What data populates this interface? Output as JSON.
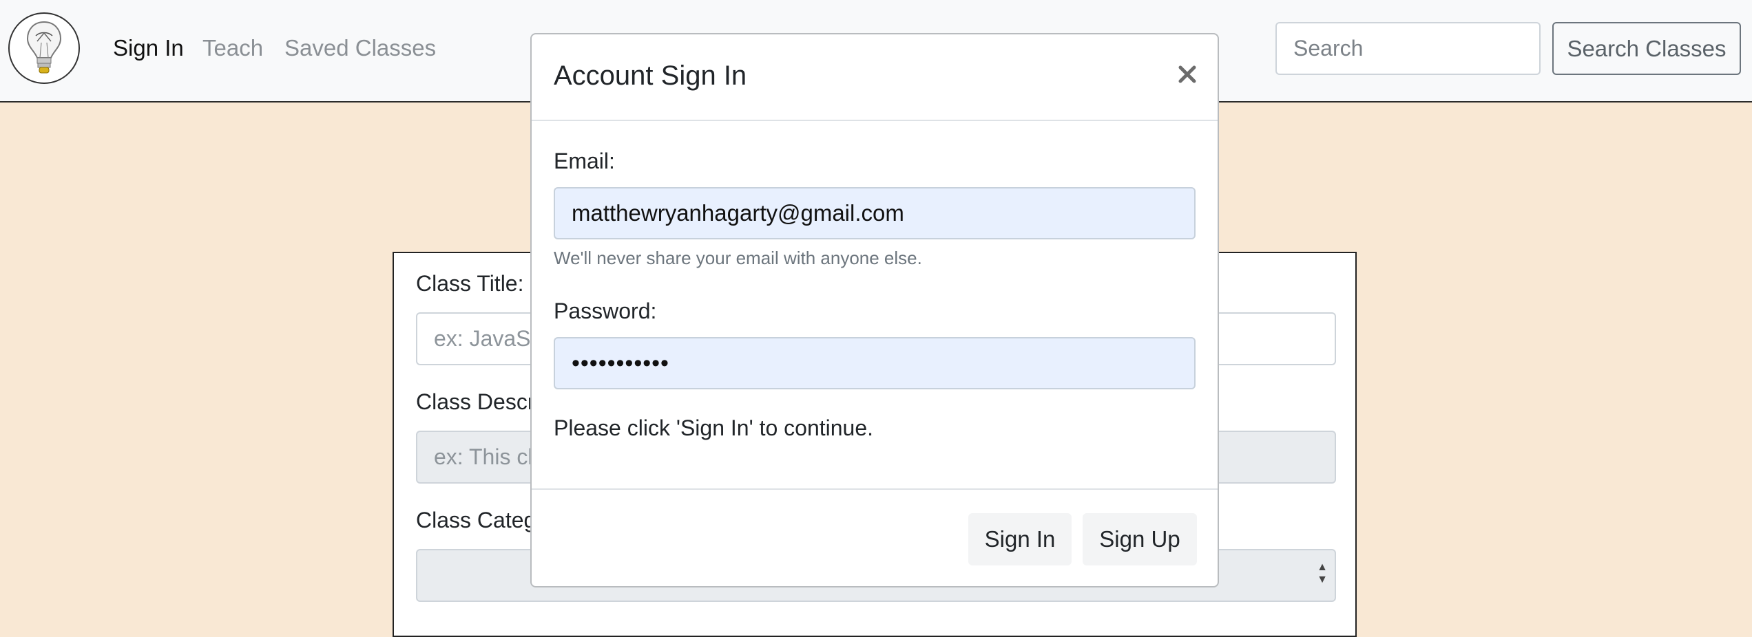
{
  "navbar": {
    "logo_icon": "lightbulb-icon",
    "links": {
      "sign_in": "Sign In",
      "teach": "Teach",
      "saved_classes": "Saved Classes"
    },
    "search": {
      "placeholder": "Search",
      "button_label": "Search Classes"
    }
  },
  "form": {
    "class_title_label": "Class Title:",
    "class_title_placeholder": "ex: JavaSc",
    "class_description_label": "Class Descr",
    "class_description_placeholder": "ex: This cl",
    "class_category_label": "Class Categ",
    "select_arrows_icon": "select-arrows-icon"
  },
  "modal": {
    "title": "Account Sign In",
    "close_icon": "close-icon",
    "email_label": "Email:",
    "email_value": "matthewryanhagarty@gmail.com",
    "email_help": "We'll never share your email with anyone else.",
    "password_label": "Password:",
    "password_masked": "•••••••••••",
    "status": "Please click 'Sign In' to continue.",
    "sign_in_button": "Sign In",
    "sign_up_button": "Sign Up"
  },
  "colors": {
    "page_background": "#f9e8d4",
    "navbar_background": "#f8f9fa",
    "autofill_background": "#e8f0fe"
  }
}
